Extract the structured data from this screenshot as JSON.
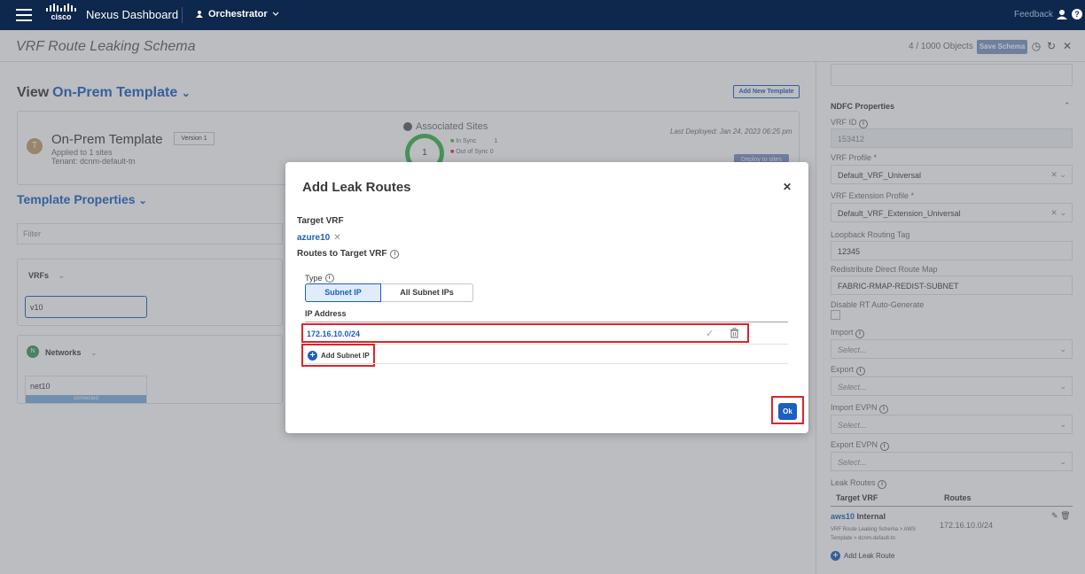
{
  "topnav": {
    "brand": "cisco",
    "app_title": "Nexus Dashboard",
    "context": "Orchestrator",
    "feedback": "Feedback"
  },
  "header": {
    "title": "VRF Route Leaking Schema",
    "object_count": "4 / 1000 Objects",
    "save_label": "Save Schema"
  },
  "view": {
    "label": "View",
    "template_name": "On-Prem Template",
    "add_template_label": "Add New Template"
  },
  "template_card": {
    "avatar_letter": "T",
    "name": "On-Prem Template",
    "version": "Version 1",
    "applied": "Applied to 1 sites",
    "tenant": "Tenant: dcnm-default-tn",
    "associated_sites": "Associated Sites",
    "site_count": "1",
    "in_sync_label": "In Sync",
    "in_sync_count": "1",
    "out_of_sync_label": "Out of Sync",
    "out_of_sync_count": "0",
    "last_deployed": "Last Deployed: Jan 24, 2023 06:25 pm",
    "deploy_label": "Deploy to sites",
    "colors": {
      "in_sync": "#3cb34a",
      "out_of_sync": "#d9262c"
    }
  },
  "template_properties": {
    "label": "Template Properties",
    "filter_placeholder": "Filter",
    "vrfs_label": "VRFs",
    "vrf_item": "v10",
    "networks_label": "Networks",
    "network_icon_letter": "N",
    "network_item": "net10",
    "network_status": "connected"
  },
  "right_panel": {
    "section_title": "NDFC Properties",
    "vrf_id_label": "VRF ID",
    "vrf_id_value": "153412",
    "vrf_profile_label": "VRF Profile *",
    "vrf_profile_value": "Default_VRF_Universal",
    "vrf_ext_profile_label": "VRF Extension Profile *",
    "vrf_ext_profile_value": "Default_VRF_Extension_Universal",
    "loopback_label": "Loopback Routing Tag",
    "loopback_value": "12345",
    "redistribute_label": "Redistribute Direct Route Map",
    "redistribute_value": "FABRIC-RMAP-REDIST-SUBNET",
    "disable_rt_label": "Disable RT Auto-Generate",
    "import_label": "Import",
    "export_label": "Export",
    "import_evpn_label": "Import EVPN",
    "export_evpn_label": "Export EVPN",
    "select_placeholder": "Select...",
    "leak_routes_label": "Leak Routes",
    "col_target_vrf": "Target VRF",
    "col_routes": "Routes",
    "leak_row": {
      "vrf": "aws10",
      "scope": "Internal",
      "desc": "VRF Route Leaking Schema > AWS Template > dcnm-default-tn",
      "route": "172.16.10.0/24"
    },
    "add_leak_route": "Add Leak Route"
  },
  "modal": {
    "title": "Add Leak Routes",
    "target_vrf_label": "Target VRF",
    "target_vrf_value": "azure10",
    "routes_label": "Routes to Target VRF",
    "type_label": "Type",
    "type_options": [
      "Subnet IP",
      "All Subnet IPs"
    ],
    "ip_header": "IP Address",
    "ip_value": "172.16.10.0/24",
    "add_subnet_label": "Add Subnet IP",
    "ok_label": "Ok",
    "highlight_color": "#d9262c"
  }
}
